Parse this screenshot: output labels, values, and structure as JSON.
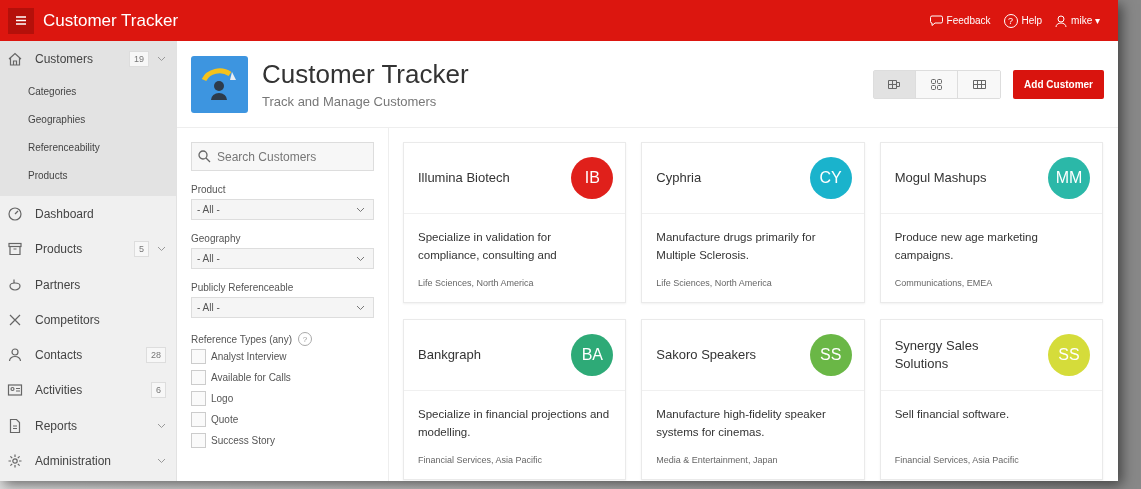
{
  "header": {
    "title": "Customer Tracker",
    "links": [
      {
        "kind": "feedback",
        "label": "Feedback"
      },
      {
        "kind": "help",
        "label": "Help",
        "glyph": "?"
      },
      {
        "kind": "user",
        "label": "mike ▾"
      }
    ]
  },
  "sidebar": {
    "items": [
      {
        "label": "Customers",
        "badge": "19",
        "submenu": true,
        "selected": true,
        "children": [
          {
            "label": "Categories"
          },
          {
            "label": "Geographies"
          },
          {
            "label": "Referenceability"
          },
          {
            "label": "Products"
          }
        ]
      },
      {
        "label": "Dashboard",
        "selected": false
      },
      {
        "label": "Products",
        "badge": "5",
        "submenu": true,
        "selected": false
      },
      {
        "label": "Partners",
        "selected": false
      },
      {
        "label": "Competitors",
        "selected": false
      },
      {
        "label": "Contacts",
        "badge": "28",
        "selected": false
      },
      {
        "label": "Activities",
        "badge": "6",
        "selected": false
      },
      {
        "label": "Reports",
        "submenu": true,
        "selected": false
      },
      {
        "label": "Administration",
        "submenu": true,
        "selected": false
      }
    ]
  },
  "hero": {
    "title": "Customer Tracker",
    "subtitle": "Track and Manage Customers",
    "views": [
      {
        "kind": "grid",
        "selected": true
      },
      {
        "kind": "tiles",
        "selected": false
      },
      {
        "kind": "columns",
        "selected": false
      }
    ],
    "add_button": "Add Customer"
  },
  "filters": {
    "search": {
      "placeholder": "Search Customers"
    },
    "selects": [
      {
        "label": "Product",
        "value": "- All -"
      },
      {
        "label": "Geography",
        "value": "- All -"
      },
      {
        "label": "Publicly Referenceable",
        "value": "- All -"
      }
    ],
    "reference_types": {
      "label": "Reference Types (any)",
      "help": "?",
      "options": [
        {
          "label": "Analyst Interview",
          "checked": false
        },
        {
          "label": "Available for Calls",
          "checked": false
        },
        {
          "label": "Logo",
          "checked": false
        },
        {
          "label": "Quote",
          "checked": false
        },
        {
          "label": "Success Story",
          "checked": false
        }
      ]
    }
  },
  "cards": [
    {
      "name": "Illumina Biotech",
      "initials": "IB",
      "color": "#e0201b",
      "description": "Specialize in validation for compliance, consulting and",
      "tags": "Life Sciences, North America"
    },
    {
      "name": "Cyphria",
      "initials": "CY",
      "color": "#1ab3cc",
      "description": "Manufacture drugs primarily for Multiple Sclerosis.",
      "tags": "Life Sciences, North America"
    },
    {
      "name": "Mogul Mashups",
      "initials": "MM",
      "color": "#2bb8a8",
      "description": "Produce new age marketing campaigns.",
      "tags": "Communications, EMEA"
    },
    {
      "name": "Bankgraph",
      "initials": "BA",
      "color": "#2eaa77",
      "description": "Specialize in financial projections and modelling.",
      "tags": "Financial Services, Asia Pacific"
    },
    {
      "name": "Sakoro Speakers",
      "initials": "SS",
      "color": "#6ab746",
      "description": "Manufacture high-fidelity speaker systems for cinemas.",
      "tags": "Media & Entertainment, Japan"
    },
    {
      "name": "Synergy Sales Solutions",
      "initials": "SS",
      "color": "#d5dc3a",
      "description": "Sell financial software.",
      "tags": "Financial Services, Asia Pacific"
    }
  ]
}
